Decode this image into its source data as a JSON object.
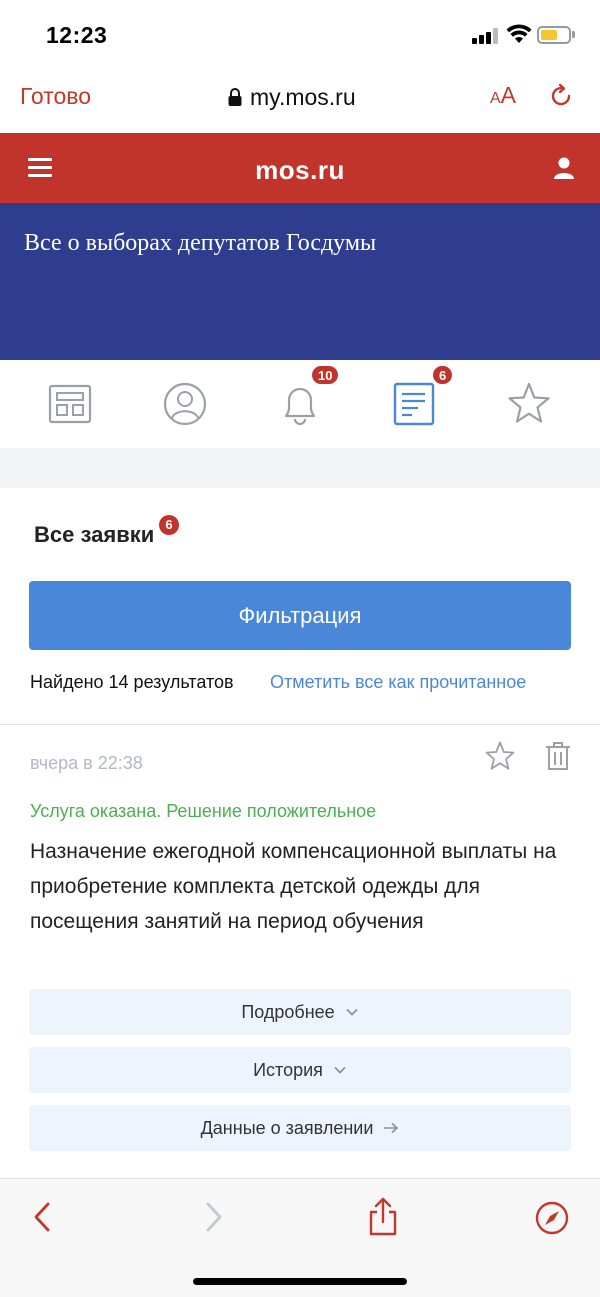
{
  "status_bar": {
    "time": "12:23",
    "battery_color": "#f4c531"
  },
  "safari": {
    "done_label": "Готово",
    "url": "my.mos.ru",
    "text_size_label_small": "A",
    "text_size_label_large": "A",
    "accent_color": "#c0392b"
  },
  "header": {
    "logo": "mos.ru",
    "color": "#c1342b"
  },
  "banner": {
    "title": "Все о выборах депутатов Госдумы",
    "color": "#2e3d8e"
  },
  "icon_nav": {
    "items": [
      {
        "name": "dashboard-icon",
        "badge": ""
      },
      {
        "name": "profile-icon",
        "badge": ""
      },
      {
        "name": "notifications-icon",
        "badge": "10"
      },
      {
        "name": "requests-icon",
        "badge": "6",
        "active": true
      },
      {
        "name": "favorites-icon",
        "badge": ""
      }
    ]
  },
  "requests": {
    "heading": "Все заявки",
    "count_badge": "6",
    "filter_label": "Фильтрация",
    "found_text": "Найдено 14 результатов",
    "mark_read_label": "Отметить все как прочитанное"
  },
  "card": {
    "date": "вчера в 22:38",
    "status": "Услуга оказана. Решение положительное",
    "status_color": "#4caf50",
    "title": "Назначение ежегодной компенсационной выплаты на приобретение комплекта детской одежды для посещения занятий на период обучения",
    "actions": [
      {
        "label": "Подробнее",
        "icon": "chevron-down-icon"
      },
      {
        "label": "История",
        "icon": "chevron-down-icon"
      },
      {
        "label": "Данные о заявлении",
        "icon": "arrow-right-icon"
      }
    ]
  },
  "toolbar": {
    "icons": [
      "back-icon",
      "forward-icon",
      "share-icon",
      "compass-icon"
    ]
  }
}
